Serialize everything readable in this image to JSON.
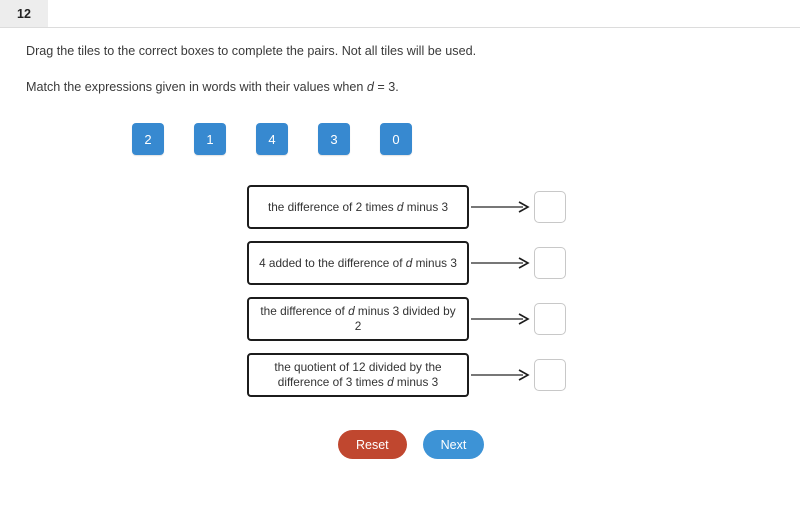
{
  "header": {
    "question_number": "12"
  },
  "instructions": {
    "line1": "Drag the tiles to the correct boxes to complete the pairs. Not all tiles will be used.",
    "line2_prefix": "Match the expressions given in words with their values when ",
    "line2_variable": "d",
    "line2_suffix": " = 3."
  },
  "tiles": [
    {
      "label": "2"
    },
    {
      "label": "1"
    },
    {
      "label": "4"
    },
    {
      "label": "3"
    },
    {
      "label": "0"
    }
  ],
  "matches": [
    {
      "expression_parts": {
        "before": "the difference of 2 times ",
        "variable": "d",
        "after": " minus 3"
      },
      "drop_value": ""
    },
    {
      "expression_parts": {
        "before": "4 added to the difference of ",
        "variable": "d",
        "after": " minus 3"
      },
      "drop_value": ""
    },
    {
      "expression_parts": {
        "before": "the difference of ",
        "variable": "d",
        "after": " minus 3 divided by 2"
      },
      "drop_value": ""
    },
    {
      "expression_parts": {
        "before": "the quotient of 12 divided by the difference of 3 times ",
        "variable": "d",
        "after": " minus 3"
      },
      "drop_value": ""
    }
  ],
  "buttons": {
    "reset_label": "Reset",
    "next_label": "Next"
  },
  "colors": {
    "tile_blue": "#3789d0",
    "reset_red": "#c0472f",
    "next_blue": "#3d93d6",
    "tab_gray": "#ededed",
    "box_border": "#1c1c1c",
    "drop_border": "#c8c8c8"
  },
  "icons": {
    "arrow": "arrow-right-icon"
  }
}
